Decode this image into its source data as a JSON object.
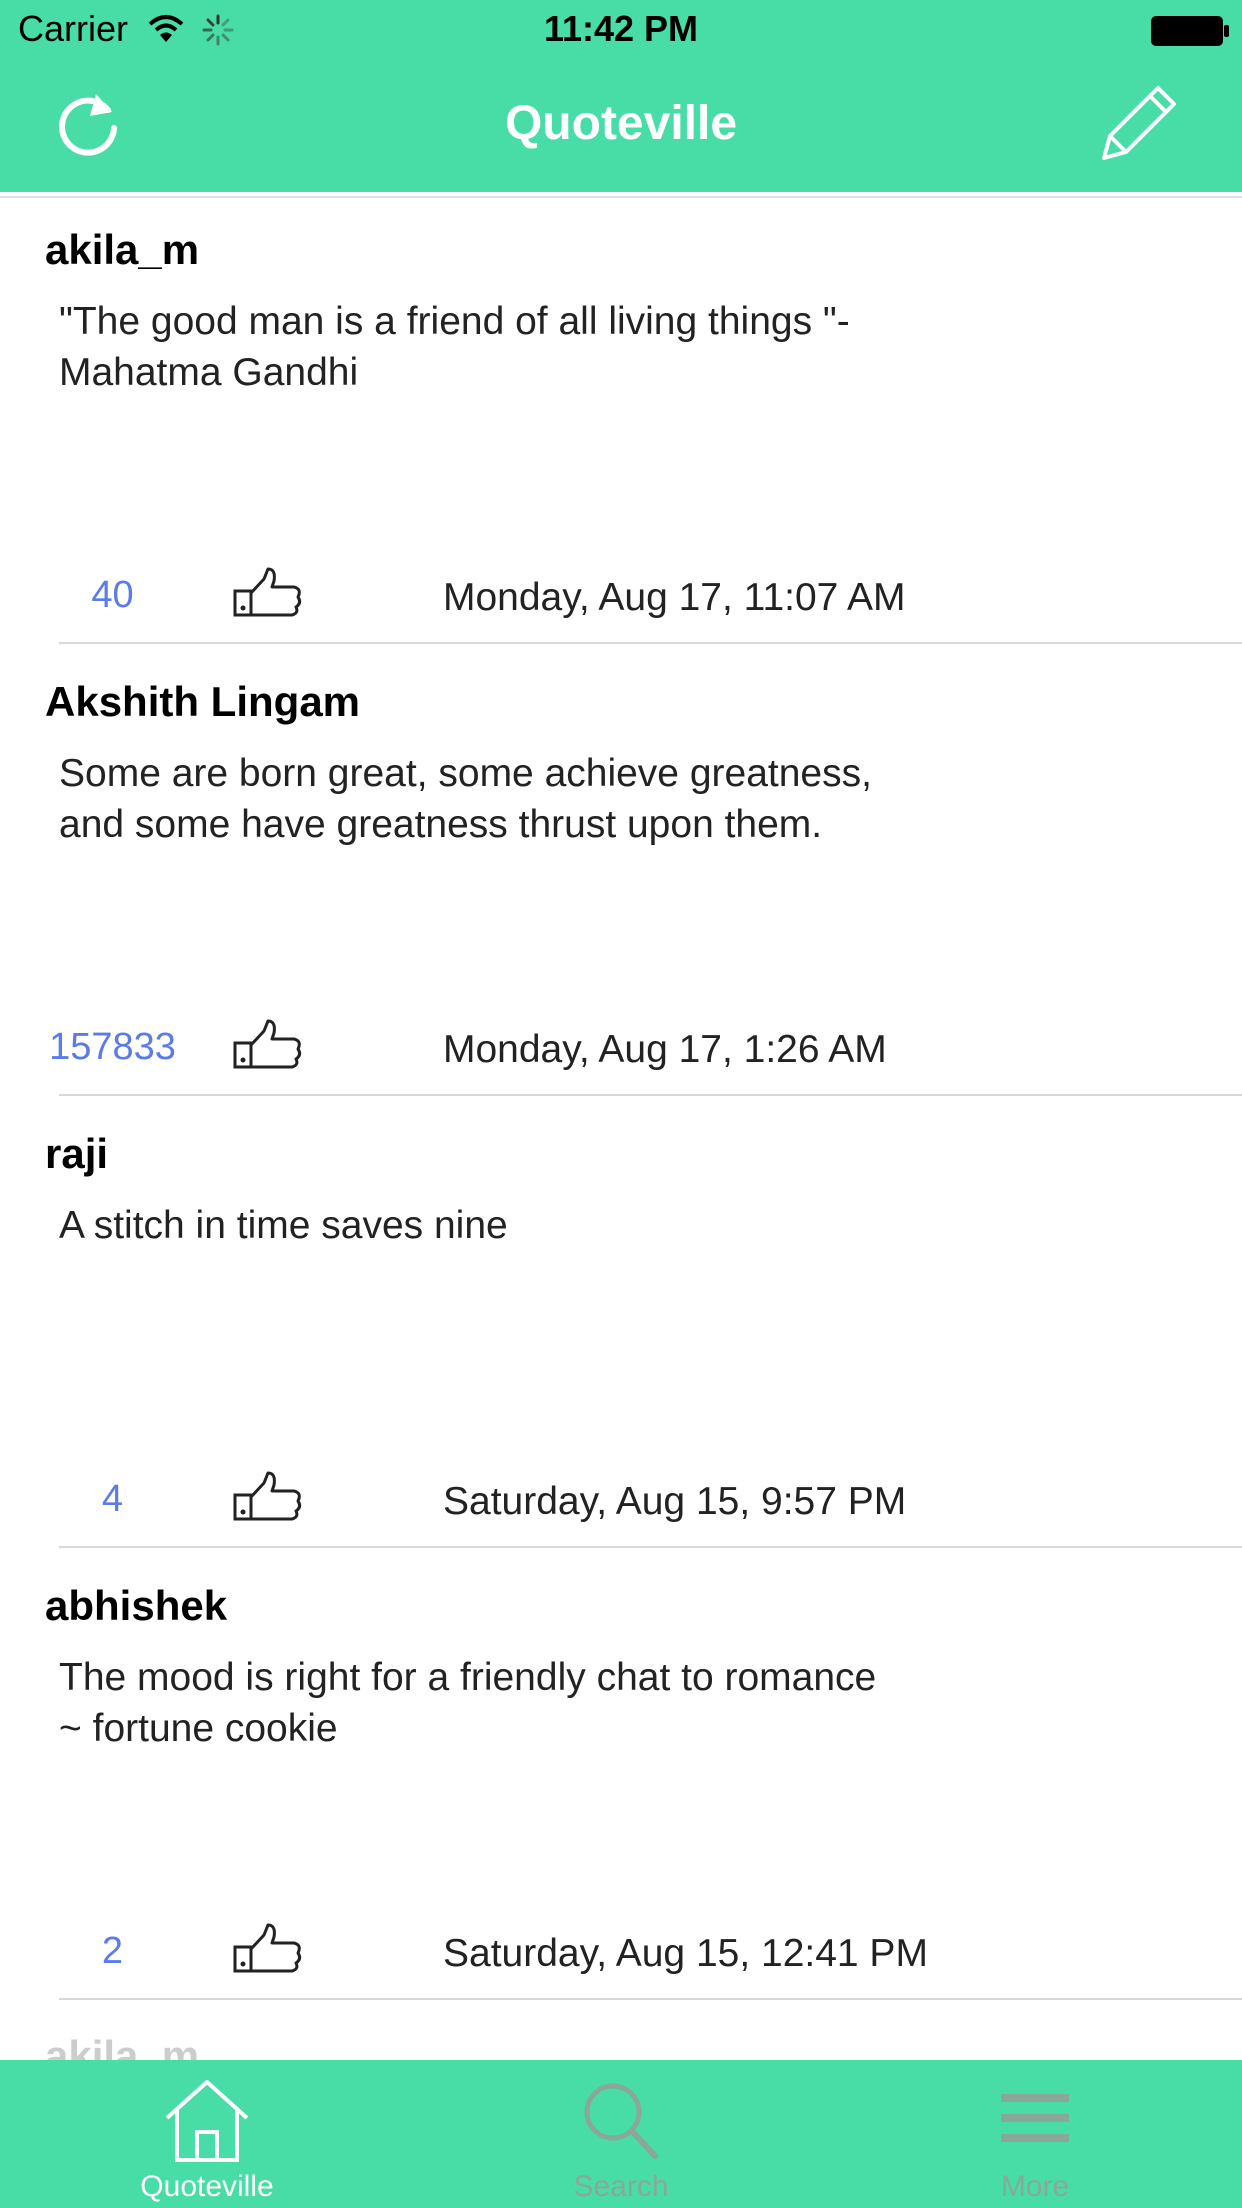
{
  "status_bar": {
    "carrier": "Carrier",
    "time": "11:42 PM"
  },
  "nav": {
    "title": "Quoteville",
    "left_icon": "refresh-icon",
    "right_icon": "compose-icon"
  },
  "colors": {
    "accent": "#48dca6",
    "likes_count": "#5b7be6",
    "tab_active": "#ffffff",
    "tab_inactive": "#8aa89a"
  },
  "quotes": [
    {
      "user": "akila_m",
      "text": "\"The good man is a friend of all living things \"-\nMahatma Gandhi",
      "likes": "40",
      "date": "Monday, Aug 17, 11:07 AM"
    },
    {
      "user": "Akshith Lingam",
      "text": "Some are born great, some achieve greatness,\nand some have greatness thrust upon them.",
      "likes": "157833",
      "date": "Monday, Aug 17, 1:26 AM"
    },
    {
      "user": "raji",
      "text": "A stitch in time saves nine",
      "likes": "4",
      "date": "Saturday, Aug 15, 9:57 PM"
    },
    {
      "user": "abhishek",
      "text": "The mood is right for a friendly chat to romance\n~ fortune cookie",
      "likes": "2",
      "date": "Saturday, Aug 15, 12:41 PM"
    }
  ],
  "partial_next_user": "akila_m",
  "tabs": [
    {
      "label": "Quoteville",
      "icon": "home-icon",
      "active": true
    },
    {
      "label": "Search",
      "icon": "search-icon",
      "active": false
    },
    {
      "label": "More",
      "icon": "menu-icon",
      "active": false
    }
  ]
}
